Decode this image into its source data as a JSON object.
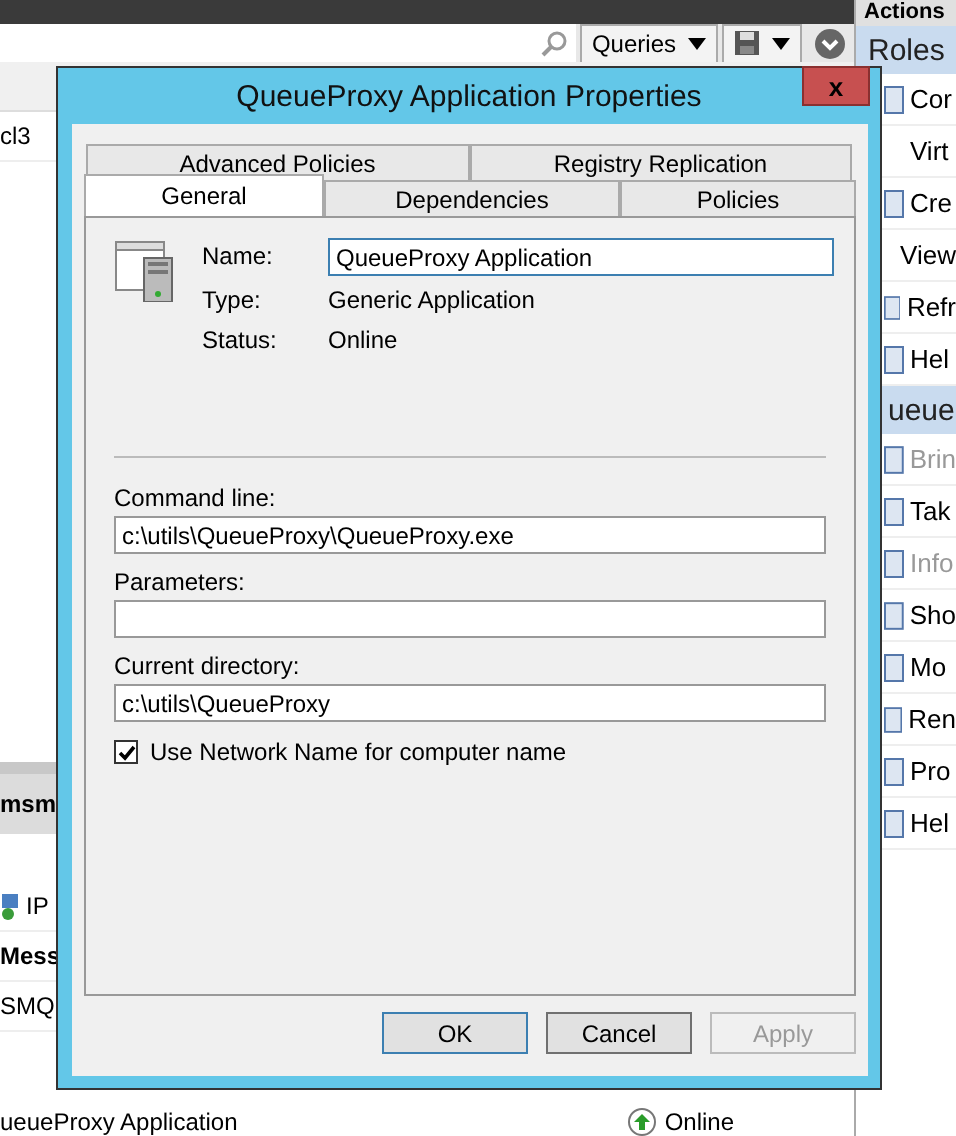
{
  "background": {
    "toolbar": {
      "queries_button": "Queries"
    },
    "left_rows": [
      {
        "text": "cl3",
        "kind": "row"
      },
      {
        "text": "msm",
        "kind": "header"
      },
      {
        "text": "IP",
        "kind": "icon-row"
      },
      {
        "text": "Mess",
        "kind": "bold-row"
      },
      {
        "text": "SMQ",
        "kind": "row"
      }
    ],
    "bottom_row": {
      "name": "ueueProxy Application",
      "status": "Online"
    },
    "actions_pane": {
      "header": "Actions",
      "groups": [
        {
          "title": "Roles",
          "items": [
            {
              "label": "Cor",
              "kind": "icon",
              "disabled": false
            },
            {
              "label": "Virt",
              "kind": "plain",
              "disabled": false
            },
            {
              "label": "Cre",
              "kind": "icon",
              "disabled": false
            },
            {
              "label": "View",
              "kind": "plain",
              "disabled": false
            },
            {
              "label": "Refr",
              "kind": "icon",
              "disabled": false
            },
            {
              "label": "Hel",
              "kind": "icon",
              "disabled": false
            }
          ]
        },
        {
          "title": "ueue",
          "items": [
            {
              "label": "Brin",
              "kind": "icon",
              "disabled": true
            },
            {
              "label": "Tak",
              "kind": "icon",
              "disabled": false
            },
            {
              "label": "Info",
              "kind": "icon",
              "disabled": true
            },
            {
              "label": "Sho",
              "kind": "icon",
              "disabled": false
            },
            {
              "label": "Mo",
              "kind": "icon",
              "disabled": false
            },
            {
              "label": "Ren",
              "kind": "icon",
              "disabled": false
            },
            {
              "label": "Pro",
              "kind": "icon",
              "disabled": false
            },
            {
              "label": "Hel",
              "kind": "icon",
              "disabled": false
            }
          ]
        }
      ]
    }
  },
  "dialog": {
    "title": "QueueProxy Application Properties",
    "close": "x",
    "tab_rows": [
      [
        {
          "label": "Advanced Policies",
          "selected": false
        },
        {
          "label": "Registry Replication",
          "selected": false
        }
      ],
      [
        {
          "label": "General",
          "selected": true
        },
        {
          "label": "Dependencies",
          "selected": false
        },
        {
          "label": "Policies",
          "selected": false
        }
      ]
    ],
    "name_label": "Name:",
    "name_value": "QueueProxy Application",
    "info": [
      {
        "label": "Type:",
        "value": "Generic Application"
      },
      {
        "label": "Status:",
        "value": "Online"
      }
    ],
    "fields": [
      {
        "label": "Command line:",
        "value": "c:\\utils\\QueueProxy\\QueueProxy.exe"
      },
      {
        "label": "Parameters:"
      },
      {
        "label": "Current directory:",
        "value": "c:\\utils\\QueueProxy"
      }
    ],
    "checkbox": {
      "label": "Use Network Name for computer name",
      "checked": true
    },
    "buttons": [
      {
        "label": "OK",
        "kind": "default",
        "disabled": false
      },
      {
        "label": "Cancel",
        "kind": "normal",
        "disabled": false
      },
      {
        "label": "Apply",
        "kind": "normal",
        "disabled": true
      }
    ]
  }
}
